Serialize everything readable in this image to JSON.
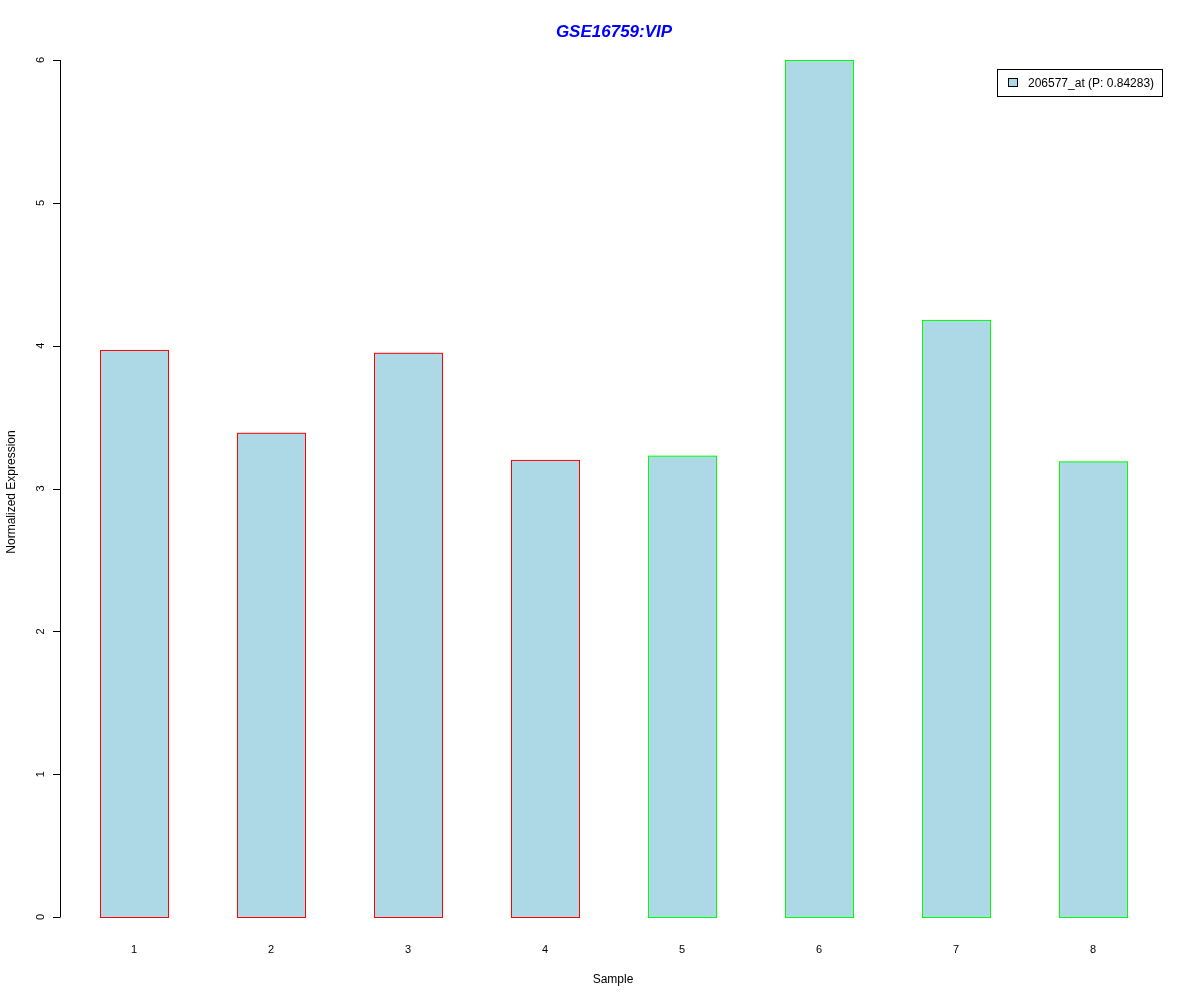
{
  "chart_data": {
    "type": "bar",
    "title": "GSE16759:VIP",
    "xlabel": "Sample",
    "ylabel": "Normalized Expression",
    "categories": [
      "1",
      "2",
      "3",
      "4",
      "5",
      "6",
      "7",
      "8"
    ],
    "series": [
      {
        "name": "206577_at (P: 0.84283)",
        "color": "#add8e6",
        "values": [
          3.97,
          3.39,
          3.95,
          3.2,
          3.23,
          6.0,
          4.18,
          3.19
        ]
      }
    ],
    "ylim": [
      0,
      6
    ],
    "yticks": [
      0,
      1,
      2,
      3,
      4,
      5,
      6
    ]
  },
  "bar_outlines": [
    {
      "color": "#ff0000"
    },
    {
      "color": "#ff0000"
    },
    {
      "color": "#ff0000"
    },
    {
      "color": "#ff0000"
    },
    {
      "color": "#00ff00"
    },
    {
      "color": "#00ff00"
    },
    {
      "color": "#00ff00"
    },
    {
      "color": "#00ff00"
    }
  ]
}
